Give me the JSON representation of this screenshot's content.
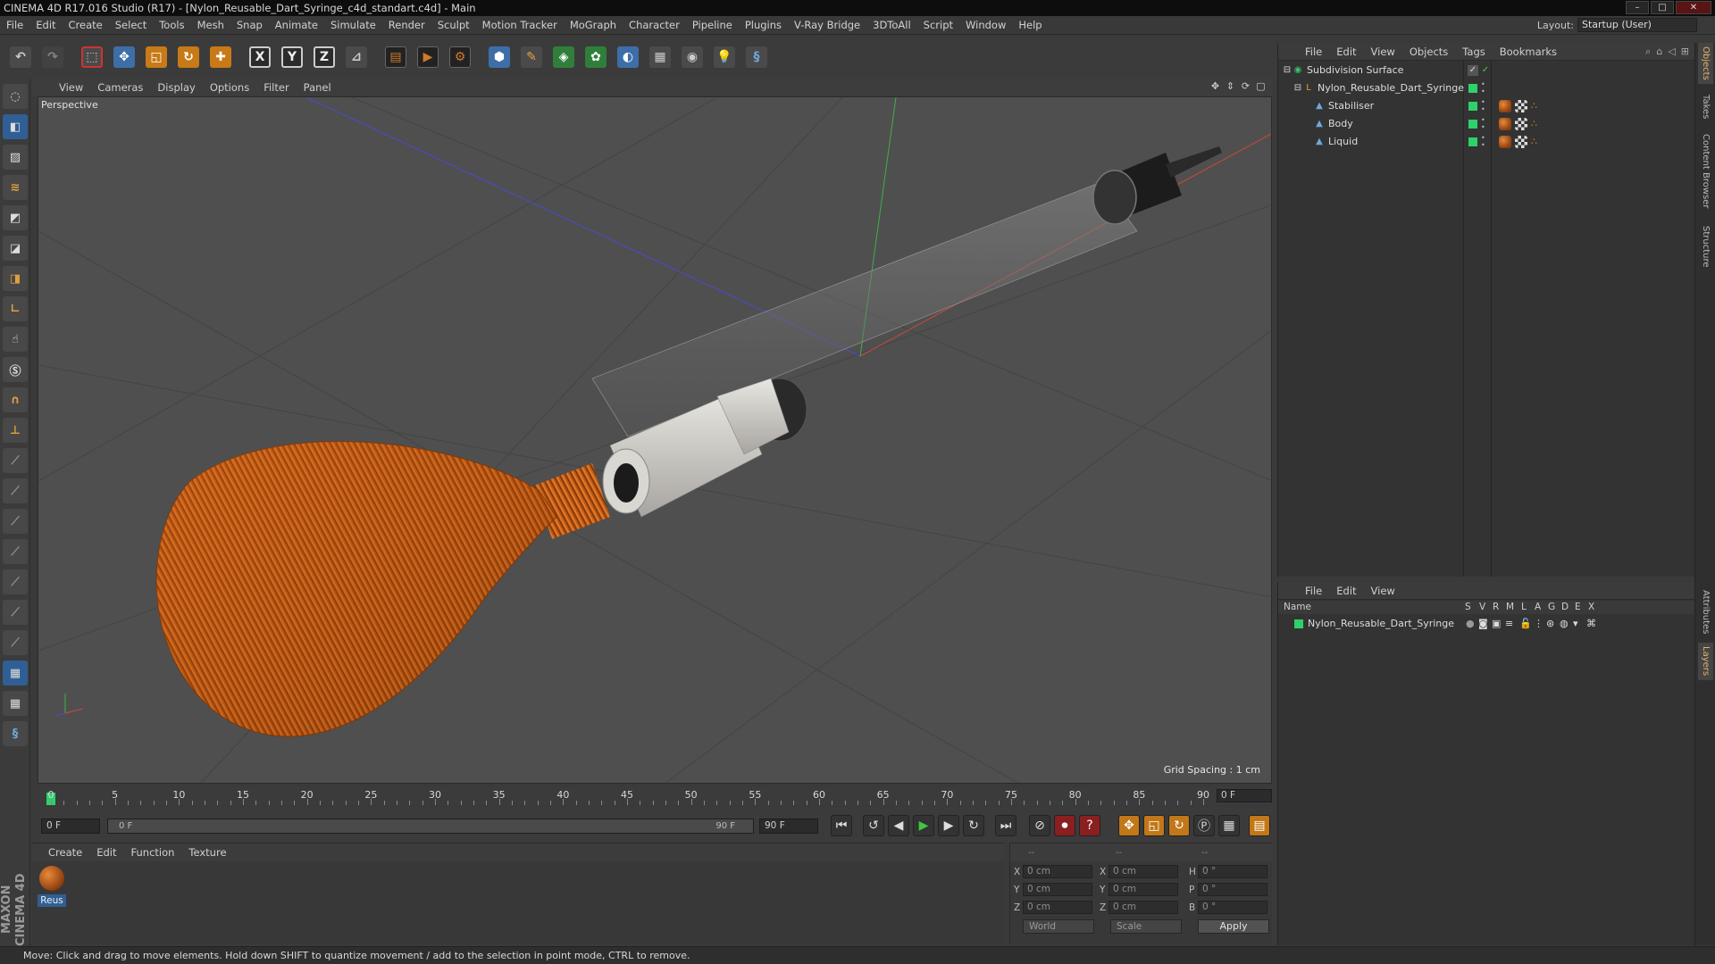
{
  "window": {
    "title": "CINEMA 4D R17.016 Studio (R17) - [Nylon_Reusable_Dart_Syringe_c4d_standart.c4d] - Main"
  },
  "menus": [
    "File",
    "Edit",
    "Create",
    "Select",
    "Tools",
    "Mesh",
    "Snap",
    "Animate",
    "Simulate",
    "Render",
    "Sculpt",
    "Motion Tracker",
    "MoGraph",
    "Character",
    "Pipeline",
    "Plugins",
    "V-Ray Bridge",
    "3DToAll",
    "Script",
    "Window",
    "Help"
  ],
  "layout": {
    "label": "Layout:",
    "value": "Startup (User)"
  },
  "toolbar": {
    "axis_x": "X",
    "axis_y": "Y",
    "axis_z": "Z"
  },
  "viewport": {
    "menus": [
      "View",
      "Cameras",
      "Display",
      "Options",
      "Filter",
      "Panel"
    ],
    "label": "Perspective",
    "grid_spacing": "Grid Spacing : 1 cm"
  },
  "timeline": {
    "ticks": [
      "0",
      "5",
      "10",
      "15",
      "20",
      "25",
      "30",
      "35",
      "40",
      "45",
      "50",
      "55",
      "60",
      "65",
      "70",
      "75",
      "80",
      "85",
      "90"
    ],
    "current": "0 F",
    "start": "0 F",
    "range_start": "0 F",
    "range_end": "90 F",
    "end": "90 F"
  },
  "material_manager": {
    "menus": [
      "Create",
      "Edit",
      "Function",
      "Texture"
    ],
    "materials": [
      {
        "name": "Reus"
      }
    ]
  },
  "coordinates": {
    "header": [
      "--",
      "--",
      "--"
    ],
    "rows": [
      {
        "l1": "X",
        "v1": "0 cm",
        "l2": "X",
        "v2": "0 cm",
        "l3": "H",
        "v3": "0 °"
      },
      {
        "l1": "Y",
        "v1": "0 cm",
        "l2": "Y",
        "v2": "0 cm",
        "l3": "P",
        "v3": "0 °"
      },
      {
        "l1": "Z",
        "v1": "0 cm",
        "l2": "Z",
        "v2": "0 cm",
        "l3": "B",
        "v3": "0 °"
      }
    ],
    "space": "World",
    "mode": "Scale",
    "apply": "Apply"
  },
  "object_manager": {
    "menus": [
      "File",
      "Edit",
      "View",
      "Objects",
      "Tags",
      "Bookmarks"
    ],
    "objects": [
      {
        "name": "Subdivision Surface"
      },
      {
        "name": "Nylon_Reusable_Dart_Syringe"
      },
      {
        "name": "Stabiliser"
      },
      {
        "name": "Body"
      },
      {
        "name": "Liquid"
      }
    ]
  },
  "layer_manager": {
    "menus": [
      "File",
      "Edit",
      "View"
    ],
    "columns": [
      "Name",
      "S",
      "V",
      "R",
      "M",
      "L",
      "A",
      "G",
      "D",
      "E",
      "X"
    ],
    "layers": [
      {
        "name": "Nylon_Reusable_Dart_Syringe"
      }
    ]
  },
  "right_tabs": [
    "Objects",
    "Takes",
    "Content Browser",
    "Structure",
    "Attributes",
    "Layers"
  ],
  "status": "Move: Click and drag to move elements. Hold down SHIFT to quantize movement / add to the selection in point mode, CTRL to remove.",
  "colors": {
    "accent_blue": "#2f5f94",
    "brand_orange": "#c77a17",
    "layer_green": "#2ed16b"
  }
}
